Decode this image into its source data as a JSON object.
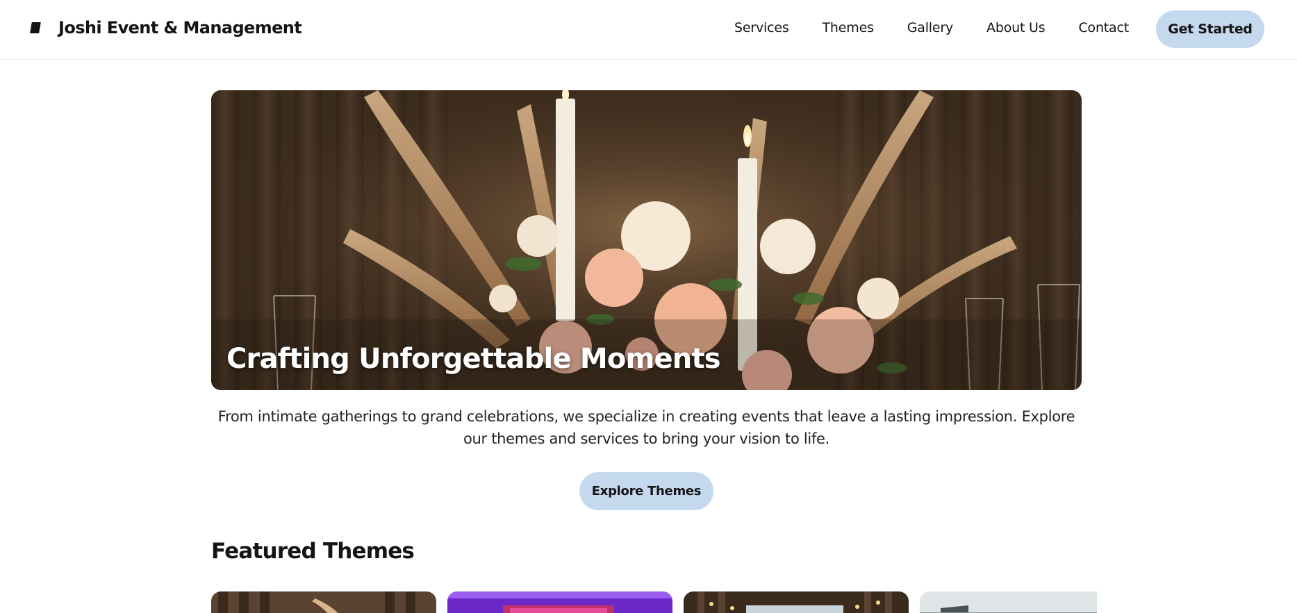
{
  "header": {
    "brand_name": "Joshi Event & Management",
    "logo_icon": "logo-mark-icon",
    "nav": [
      "Services",
      "Themes",
      "Gallery",
      "About Us",
      "Contact"
    ],
    "cta_label": "Get Started"
  },
  "hero": {
    "title": "Crafting Unforgettable Moments",
    "image": "candles-and-roses-table-centerpiece"
  },
  "tagline": "From intimate gatherings to grand celebrations, we specialize in creating events that leave a lasting impression. Explore our themes and services to bring your vision to life.",
  "explore_label": "Explore Themes",
  "featured": {
    "title": "Featured Themes",
    "cards": [
      {
        "image": "rustic-pampas-theme"
      },
      {
        "image": "purple-stage-theme"
      },
      {
        "image": "string-lights-theme"
      },
      {
        "image": "outdoor-terrace-theme"
      }
    ]
  },
  "colors": {
    "accent": "#c5d9ee",
    "text": "#141414",
    "hero_overlay": "#4b3623"
  }
}
